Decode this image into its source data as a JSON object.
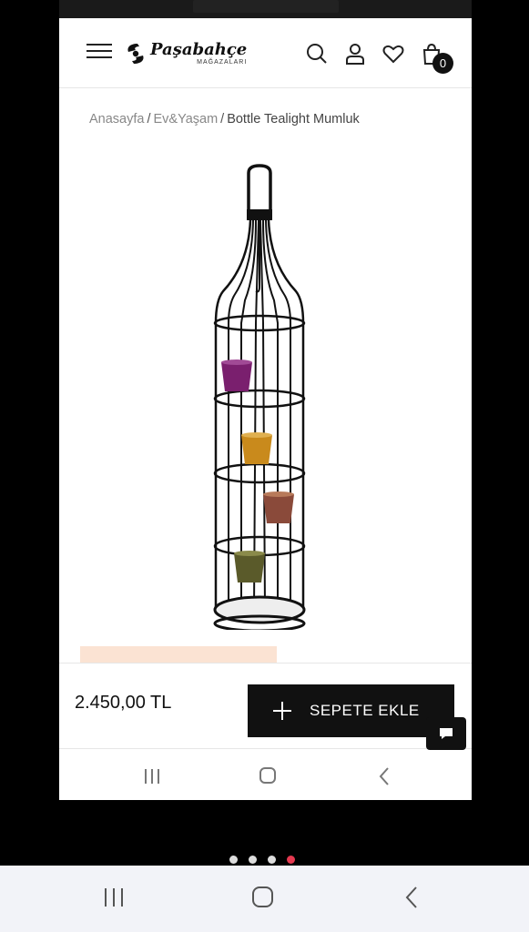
{
  "header": {
    "logo_name": "Paşabahçe",
    "logo_sub": "MAĞAZALARI",
    "cart_count": "0"
  },
  "breadcrumb": {
    "items": [
      "Anasayfa",
      "Ev&Yaşam"
    ],
    "current": "Bottle Tealight Mumluk",
    "separator": "/"
  },
  "product": {
    "price": "2.450,00 TL",
    "add_to_cart_label": "SEPETE EKLE",
    "candle_colors": [
      "#7a1f6e",
      "#c98a1c",
      "#8a4a3a",
      "#5a5a2a"
    ]
  },
  "colors": {
    "brand_black": "#111111",
    "promo_bg": "#fbe3d3",
    "active_dot": "#e53950"
  },
  "pager": {
    "count": 4,
    "active_index": 3
  }
}
